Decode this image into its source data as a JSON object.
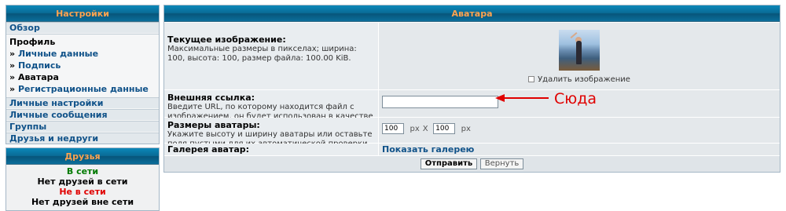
{
  "sidebar": {
    "title": "Настройки",
    "overview": "Обзор",
    "profile": {
      "title": "Профиль",
      "items": [
        {
          "arrow": "» ",
          "label": "Личные данные"
        },
        {
          "arrow": "» ",
          "label": "Подпись"
        },
        {
          "arrow": "» ",
          "label": "Аватара"
        },
        {
          "arrow": "» ",
          "label": "Регистрационные данные"
        }
      ]
    },
    "sections": [
      "Личные настройки",
      "Личные сообщения",
      "Группы",
      "Друзья и недруги"
    ]
  },
  "friends": {
    "title": "Друзья",
    "online_label": "В сети",
    "online_empty": "Нет друзей в сети",
    "offline_label": "Не в сети",
    "offline_empty": "Нет друзей вне сети"
  },
  "main": {
    "title": "Аватара",
    "current": {
      "label": "Текущее изображение:",
      "explain": "Максимальные размеры в пикселах; ширина: 100, высота: 100, размер файла: 100.00 KiB.",
      "delete_label": "Удалить изображение"
    },
    "external": {
      "label": "Внешняя ссылка:",
      "explain": "Введите URL, по которому находится файл с изображением, он будет использован в качестве вашей аватары.",
      "value": ""
    },
    "dimensions": {
      "label": "Размеры аватары:",
      "explain": "Укажите высоту и ширину аватары или оставьте поля пустыми для их автоматической проверки.",
      "width": "100",
      "height": "100",
      "unit": "px",
      "separator": "X"
    },
    "gallery": {
      "label": "Галерея аватар:",
      "link": "Показать галерею"
    },
    "buttons": {
      "submit": "Отправить",
      "reset": "Вернуть"
    }
  },
  "annotation": {
    "text": "Сюда",
    "color": "#e00000"
  },
  "colors": {
    "header_text": "#ffa34f",
    "header_bg": "#0a6b96",
    "link": "#105289",
    "online": "#007a00",
    "offline": "#e00000"
  }
}
